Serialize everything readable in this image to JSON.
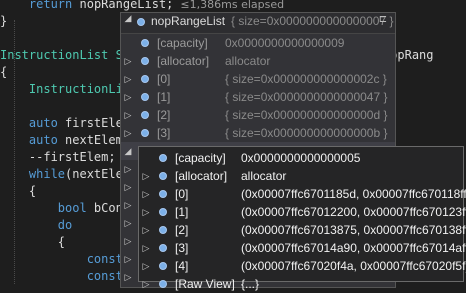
{
  "code": {
    "lines": [
      {
        "parts": [
          {
            "t": "    ",
            "c": ""
          },
          {
            "t": "return",
            "c": "kw"
          },
          {
            "t": " nopRangeList;",
            "c": ""
          }
        ]
      },
      {
        "parts": [
          {
            "t": "}",
            "c": ""
          }
        ]
      },
      {
        "parts": [
          {
            "t": "",
            "c": ""
          }
        ]
      },
      {
        "parts": [
          {
            "t": "InstructionList S",
            "c": "ty"
          },
          {
            "t": "                              const NopRang",
            "c": ""
          }
        ]
      },
      {
        "parts": [
          {
            "t": "{",
            "c": ""
          }
        ]
      },
      {
        "parts": [
          {
            "t": "    ",
            "c": ""
          },
          {
            "t": "InstructionLi",
            "c": "ty"
          }
        ]
      },
      {
        "parts": [
          {
            "t": "",
            "c": ""
          }
        ]
      },
      {
        "parts": [
          {
            "t": "    ",
            "c": ""
          },
          {
            "t": "auto",
            "c": "kw"
          },
          {
            "t": " firstEle",
            "c": ""
          }
        ]
      },
      {
        "parts": [
          {
            "t": "    ",
            "c": ""
          },
          {
            "t": "auto",
            "c": "kw"
          },
          {
            "t": " nextElem",
            "c": ""
          }
        ]
      },
      {
        "parts": [
          {
            "t": "    --firstElem;",
            "c": ""
          }
        ]
      },
      {
        "parts": [
          {
            "t": "    ",
            "c": ""
          },
          {
            "t": "while",
            "c": "kw"
          },
          {
            "t": "(nextEle",
            "c": ""
          }
        ]
      },
      {
        "parts": [
          {
            "t": "    {",
            "c": ""
          }
        ]
      },
      {
        "parts": [
          {
            "t": "        ",
            "c": ""
          },
          {
            "t": "bool",
            "c": "kw"
          },
          {
            "t": " bConti",
            "c": ""
          }
        ]
      },
      {
        "parts": [
          {
            "t": "        ",
            "c": ""
          },
          {
            "t": "do",
            "c": "kw"
          }
        ]
      },
      {
        "parts": [
          {
            "t": "        {",
            "c": ""
          }
        ]
      },
      {
        "parts": [
          {
            "t": "            ",
            "c": ""
          },
          {
            "t": "const",
            "c": "kw"
          },
          {
            "t": " s",
            "c": ""
          }
        ]
      },
      {
        "parts": [
          {
            "t": "            ",
            "c": ""
          },
          {
            "t": "const",
            "c": "kw"
          },
          {
            "t": " s",
            "c": ""
          }
        ]
      }
    ],
    "elapsed": "≤1,386ms elapsed"
  },
  "tooltip_outer": {
    "header": {
      "name": "nopRangeList",
      "value": "{ size=0x0000000000000007 }",
      "pin": "⊏"
    },
    "rows": [
      {
        "name": "[capacity]",
        "value": "0x0000000000000009",
        "expand": ""
      },
      {
        "name": "[allocator]",
        "value": "allocator",
        "expand": "▷"
      },
      {
        "name": "[0]",
        "value": "{ size=0x000000000000002c }",
        "expand": "▷"
      },
      {
        "name": "[1]",
        "value": "{ size=0x0000000000000047 }",
        "expand": "▷"
      },
      {
        "name": "[2]",
        "value": "{ size=0x000000000000000d }",
        "expand": "▷"
      },
      {
        "name": "[3]",
        "value": "{ size=0x000000000000000b }",
        "expand": "▷"
      },
      {
        "name": "[4]",
        "value": "{ size=0x0000000000000005 }",
        "expand": "◢"
      },
      {
        "name": "",
        "value": "",
        "expand": "▷"
      },
      {
        "name": "",
        "value": "",
        "expand": "▷"
      },
      {
        "name": "",
        "value": "",
        "expand": "▷"
      },
      {
        "name": "",
        "value": "",
        "expand": "▷"
      },
      {
        "name": "",
        "value": "",
        "expand": "▷"
      },
      {
        "name": "",
        "value": "",
        "expand": "▷"
      },
      {
        "name": "",
        "value": "",
        "expand": "▷"
      }
    ]
  },
  "tooltip_inner": {
    "rows": [
      {
        "name": "[capacity]",
        "value": "0x0000000000000005",
        "expand": ""
      },
      {
        "name": "[allocator]",
        "value": "allocator",
        "expand": "▷"
      },
      {
        "name": "[0]",
        "value": "(0x00007ffc6701185d, 0x00007ffc670118ff)",
        "expand": "▷"
      },
      {
        "name": "[1]",
        "value": "(0x00007ffc67012200, 0x00007ffc670123ff)",
        "expand": "▷"
      },
      {
        "name": "[2]",
        "value": "(0x00007ffc67013875, 0x00007ffc670138ff)",
        "expand": "▷"
      },
      {
        "name": "[3]",
        "value": "(0x00007ffc67014a90, 0x00007ffc67014aff)",
        "expand": "▷"
      },
      {
        "name": "[4]",
        "value": "(0x00007ffc67020f4a, 0x00007ffc67020f5f)",
        "expand": "▷"
      },
      {
        "name": "[Raw View]",
        "value": "{...}",
        "expand": "▷"
      }
    ]
  }
}
